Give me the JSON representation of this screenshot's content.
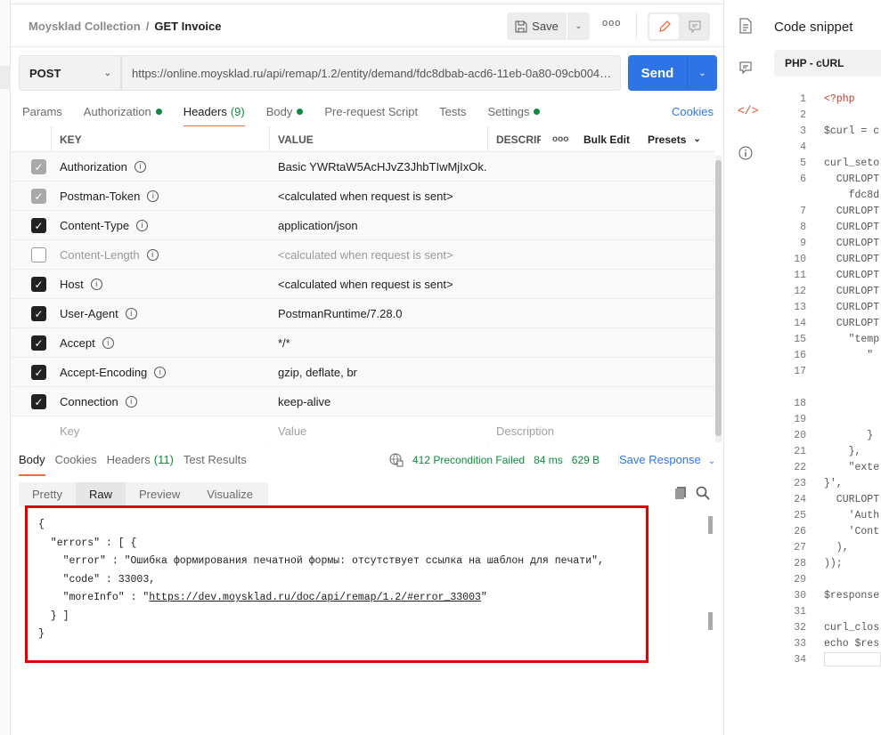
{
  "breadcrumb": {
    "collection": "Moysklad Collection",
    "separator": "/",
    "request": "GET Invoice"
  },
  "toolbar": {
    "save_label": "Save",
    "more": "ooo"
  },
  "request": {
    "method": "POST",
    "url": "https://online.moysklad.ru/api/remap/1.2/entity/demand/fdc8dbab-acd6-11eb-0a80-09cb004…",
    "send_label": "Send"
  },
  "tabs": [
    {
      "label": "Params"
    },
    {
      "label": "Authorization",
      "dot": true
    },
    {
      "label": "Headers",
      "count": "(9)",
      "active": true
    },
    {
      "label": "Body",
      "dot": true
    },
    {
      "label": "Pre-request Script"
    },
    {
      "label": "Tests"
    },
    {
      "label": "Settings",
      "dot": true
    }
  ],
  "cookies_link": "Cookies",
  "headers_table": {
    "columns": {
      "key": "KEY",
      "value": "VALUE",
      "description": "DESCRIP",
      "more": "ooo",
      "bulk_edit": "Bulk Edit",
      "presets": "Presets"
    },
    "rows": [
      {
        "key": "Authorization",
        "value": "Basic YWRtaW5AcHJvZ3JhbTIwMjIxOk...",
        "state": "gray"
      },
      {
        "key": "Postman-Token",
        "value": "<calculated when request is sent>",
        "state": "gray"
      },
      {
        "key": "Content-Type",
        "value": "application/json",
        "state": "on"
      },
      {
        "key": "Content-Length",
        "value": "<calculated when request is sent>",
        "state": "off"
      },
      {
        "key": "Host",
        "value": "<calculated when request is sent>",
        "state": "on"
      },
      {
        "key": "User-Agent",
        "value": "PostmanRuntime/7.28.0",
        "state": "on"
      },
      {
        "key": "Accept",
        "value": "*/*",
        "state": "on"
      },
      {
        "key": "Accept-Encoding",
        "value": "gzip, deflate, br",
        "state": "on"
      },
      {
        "key": "Connection",
        "value": "keep-alive",
        "state": "on"
      }
    ],
    "placeholders": {
      "key": "Key",
      "value": "Value",
      "description": "Description"
    }
  },
  "response": {
    "tabs": [
      {
        "label": "Body",
        "active": true
      },
      {
        "label": "Cookies"
      },
      {
        "label": "Headers",
        "count": "(11)"
      },
      {
        "label": "Test Results"
      }
    ],
    "status": "412 Precondition Failed",
    "time": "84 ms",
    "size": "629 B",
    "save_response": "Save Response",
    "formats": [
      "Pretty",
      "Raw",
      "Preview",
      "Visualize"
    ],
    "active_format": "Raw",
    "body_lines": [
      "{",
      "  \"errors\" : [ {",
      "    \"error\" : \"Ошибка формирования печатной формы: отсутствует ссылка на шаблон для печати\",",
      "    \"code\" : 33003,",
      "    \"moreInfo\" : \""
    ],
    "more_info_link": "https://dev.moysklad.ru/doc/api/remap/1.2/#error_33003",
    "body_tail": [
      "  } ]",
      "}"
    ]
  },
  "snippet": {
    "title": "Code snippet",
    "language": "PHP - cURL",
    "lines": [
      {
        "n": "1",
        "t": "<?php",
        "red": true
      },
      {
        "n": "2",
        "t": ""
      },
      {
        "n": "3",
        "t": "$curl = c"
      },
      {
        "n": "4",
        "t": ""
      },
      {
        "n": "5",
        "t": "curl_seto"
      },
      {
        "n": "6",
        "t": "  CURLOPT"
      },
      {
        "n": "",
        "t": "    fdc8d"
      },
      {
        "n": "7",
        "t": "  CURLOPT"
      },
      {
        "n": "8",
        "t": "  CURLOPT"
      },
      {
        "n": "9",
        "t": "  CURLOPT"
      },
      {
        "n": "10",
        "t": "  CURLOPT"
      },
      {
        "n": "11",
        "t": "  CURLOPT"
      },
      {
        "n": "12",
        "t": "  CURLOPT"
      },
      {
        "n": "13",
        "t": "  CURLOPT"
      },
      {
        "n": "14",
        "t": "  CURLOPT"
      },
      {
        "n": "15",
        "t": "    \"temp"
      },
      {
        "n": "16",
        "t": "       \""
      },
      {
        "n": "17",
        "t": ""
      },
      {
        "n": "",
        "t": ""
      },
      {
        "n": "18",
        "t": ""
      },
      {
        "n": "19",
        "t": ""
      },
      {
        "n": "20",
        "t": "       }"
      },
      {
        "n": "21",
        "t": "    },"
      },
      {
        "n": "22",
        "t": "    \"exte"
      },
      {
        "n": "23",
        "t": "}',"
      },
      {
        "n": "24",
        "t": "  CURLOPT"
      },
      {
        "n": "25",
        "t": "    'Auth"
      },
      {
        "n": "26",
        "t": "    'Cont"
      },
      {
        "n": "27",
        "t": "  ),"
      },
      {
        "n": "28",
        "t": "));"
      },
      {
        "n": "29",
        "t": ""
      },
      {
        "n": "30",
        "t": "$response"
      },
      {
        "n": "31",
        "t": ""
      },
      {
        "n": "32",
        "t": "curl_clos"
      },
      {
        "n": "33",
        "t": "echo $res"
      },
      {
        "n": "34",
        "t": ""
      }
    ]
  },
  "colors": {
    "accent": "#2f74e6",
    "active_tab": "#f26b3a",
    "success": "#0c8a3e",
    "highlight_border": "#e30000"
  }
}
